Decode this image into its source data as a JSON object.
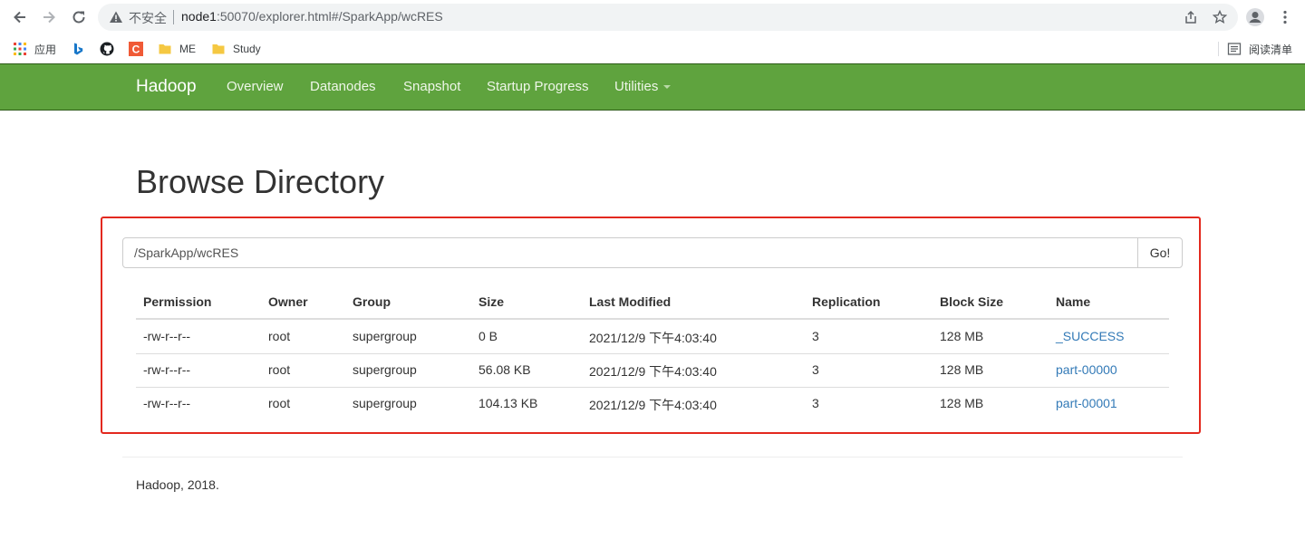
{
  "browser": {
    "insecure_label": "不安全",
    "url_host": "node1",
    "url_rest": ":50070/explorer.html#/SparkApp/wcRES",
    "bookmarks": [
      {
        "label": "应用",
        "icon": "apps-grid-icon"
      },
      {
        "label": "",
        "icon": "bing-icon"
      },
      {
        "label": "",
        "icon": "github-icon"
      },
      {
        "label": "",
        "icon": "csdn-icon"
      },
      {
        "label": "ME",
        "icon": "folder-icon"
      },
      {
        "label": "Study",
        "icon": "folder-icon"
      }
    ],
    "reading_list_label": "阅读清单"
  },
  "navbar": {
    "brand": "Hadoop",
    "links": [
      "Overview",
      "Datanodes",
      "Snapshot",
      "Startup Progress",
      "Utilities"
    ],
    "bg_color": "#5fa33e"
  },
  "page": {
    "title": "Browse Directory",
    "path_value": "/SparkApp/wcRES",
    "go_label": "Go!",
    "highlight_color": "#e3291f"
  },
  "table": {
    "headers": [
      "Permission",
      "Owner",
      "Group",
      "Size",
      "Last Modified",
      "Replication",
      "Block Size",
      "Name"
    ],
    "rows": [
      [
        "-rw-r--r--",
        "root",
        "supergroup",
        "0 B",
        "2021/12/9 下午4:03:40",
        "3",
        "128 MB",
        "_SUCCESS"
      ],
      [
        "-rw-r--r--",
        "root",
        "supergroup",
        "56.08 KB",
        "2021/12/9 下午4:03:40",
        "3",
        "128 MB",
        "part-00000"
      ],
      [
        "-rw-r--r--",
        "root",
        "supergroup",
        "104.13 KB",
        "2021/12/9 下午4:03:40",
        "3",
        "128 MB",
        "part-00001"
      ]
    ]
  },
  "footer": {
    "text": "Hadoop, 2018."
  }
}
